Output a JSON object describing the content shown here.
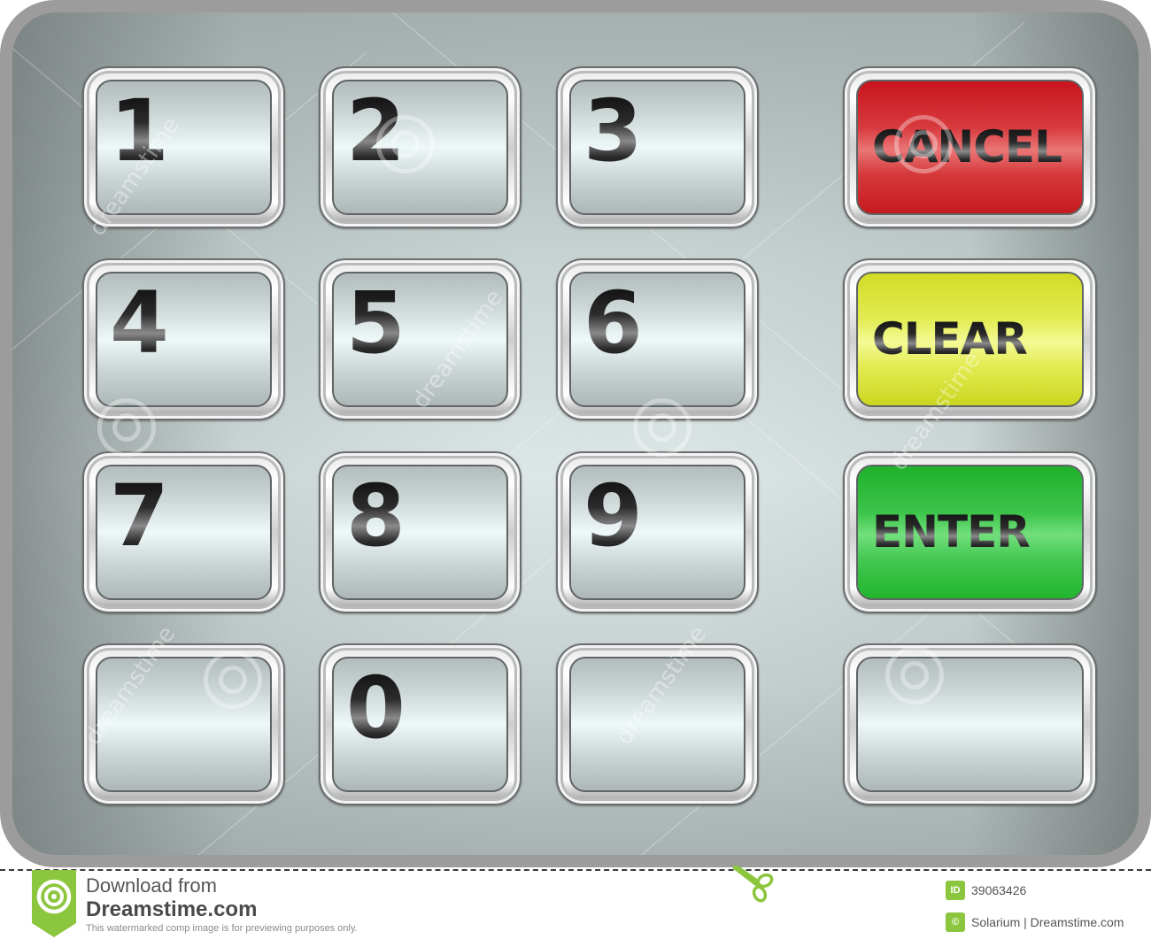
{
  "keypad": {
    "numeric_keys": [
      {
        "label": "1",
        "row": 1,
        "col": 1
      },
      {
        "label": "2",
        "row": 1,
        "col": 2
      },
      {
        "label": "3",
        "row": 1,
        "col": 3
      },
      {
        "label": "4",
        "row": 2,
        "col": 1
      },
      {
        "label": "5",
        "row": 2,
        "col": 2
      },
      {
        "label": "6",
        "row": 2,
        "col": 3
      },
      {
        "label": "7",
        "row": 3,
        "col": 1
      },
      {
        "label": "8",
        "row": 3,
        "col": 2
      },
      {
        "label": "9",
        "row": 3,
        "col": 3
      },
      {
        "label": "",
        "row": 4,
        "col": 1
      },
      {
        "label": "0",
        "row": 4,
        "col": 2
      },
      {
        "label": "",
        "row": 4,
        "col": 3
      }
    ],
    "function_keys": [
      {
        "label": "CANCEL",
        "color": "#d42a2e",
        "row": 1
      },
      {
        "label": "CLEAR",
        "color": "#e4ee4c",
        "row": 2
      },
      {
        "label": "ENTER",
        "color": "#36c044",
        "row": 3
      },
      {
        "label": "",
        "color": "#d8e2e2",
        "row": 4
      }
    ]
  },
  "watermark": {
    "text": "dreamstime",
    "download_from": "Download from",
    "brand": "Dreamstime.com",
    "note": "This watermarked comp image is for previewing purposes only.",
    "id_badge": "ID",
    "image_id": "39063426",
    "credit": "Solarium | Dreamstime.com",
    "accent_color": "#8cc63e"
  },
  "icons": {
    "logo": "dreamstime-swirl-logo",
    "cut": "scissors-icon",
    "copyright": "copyright-icon"
  }
}
